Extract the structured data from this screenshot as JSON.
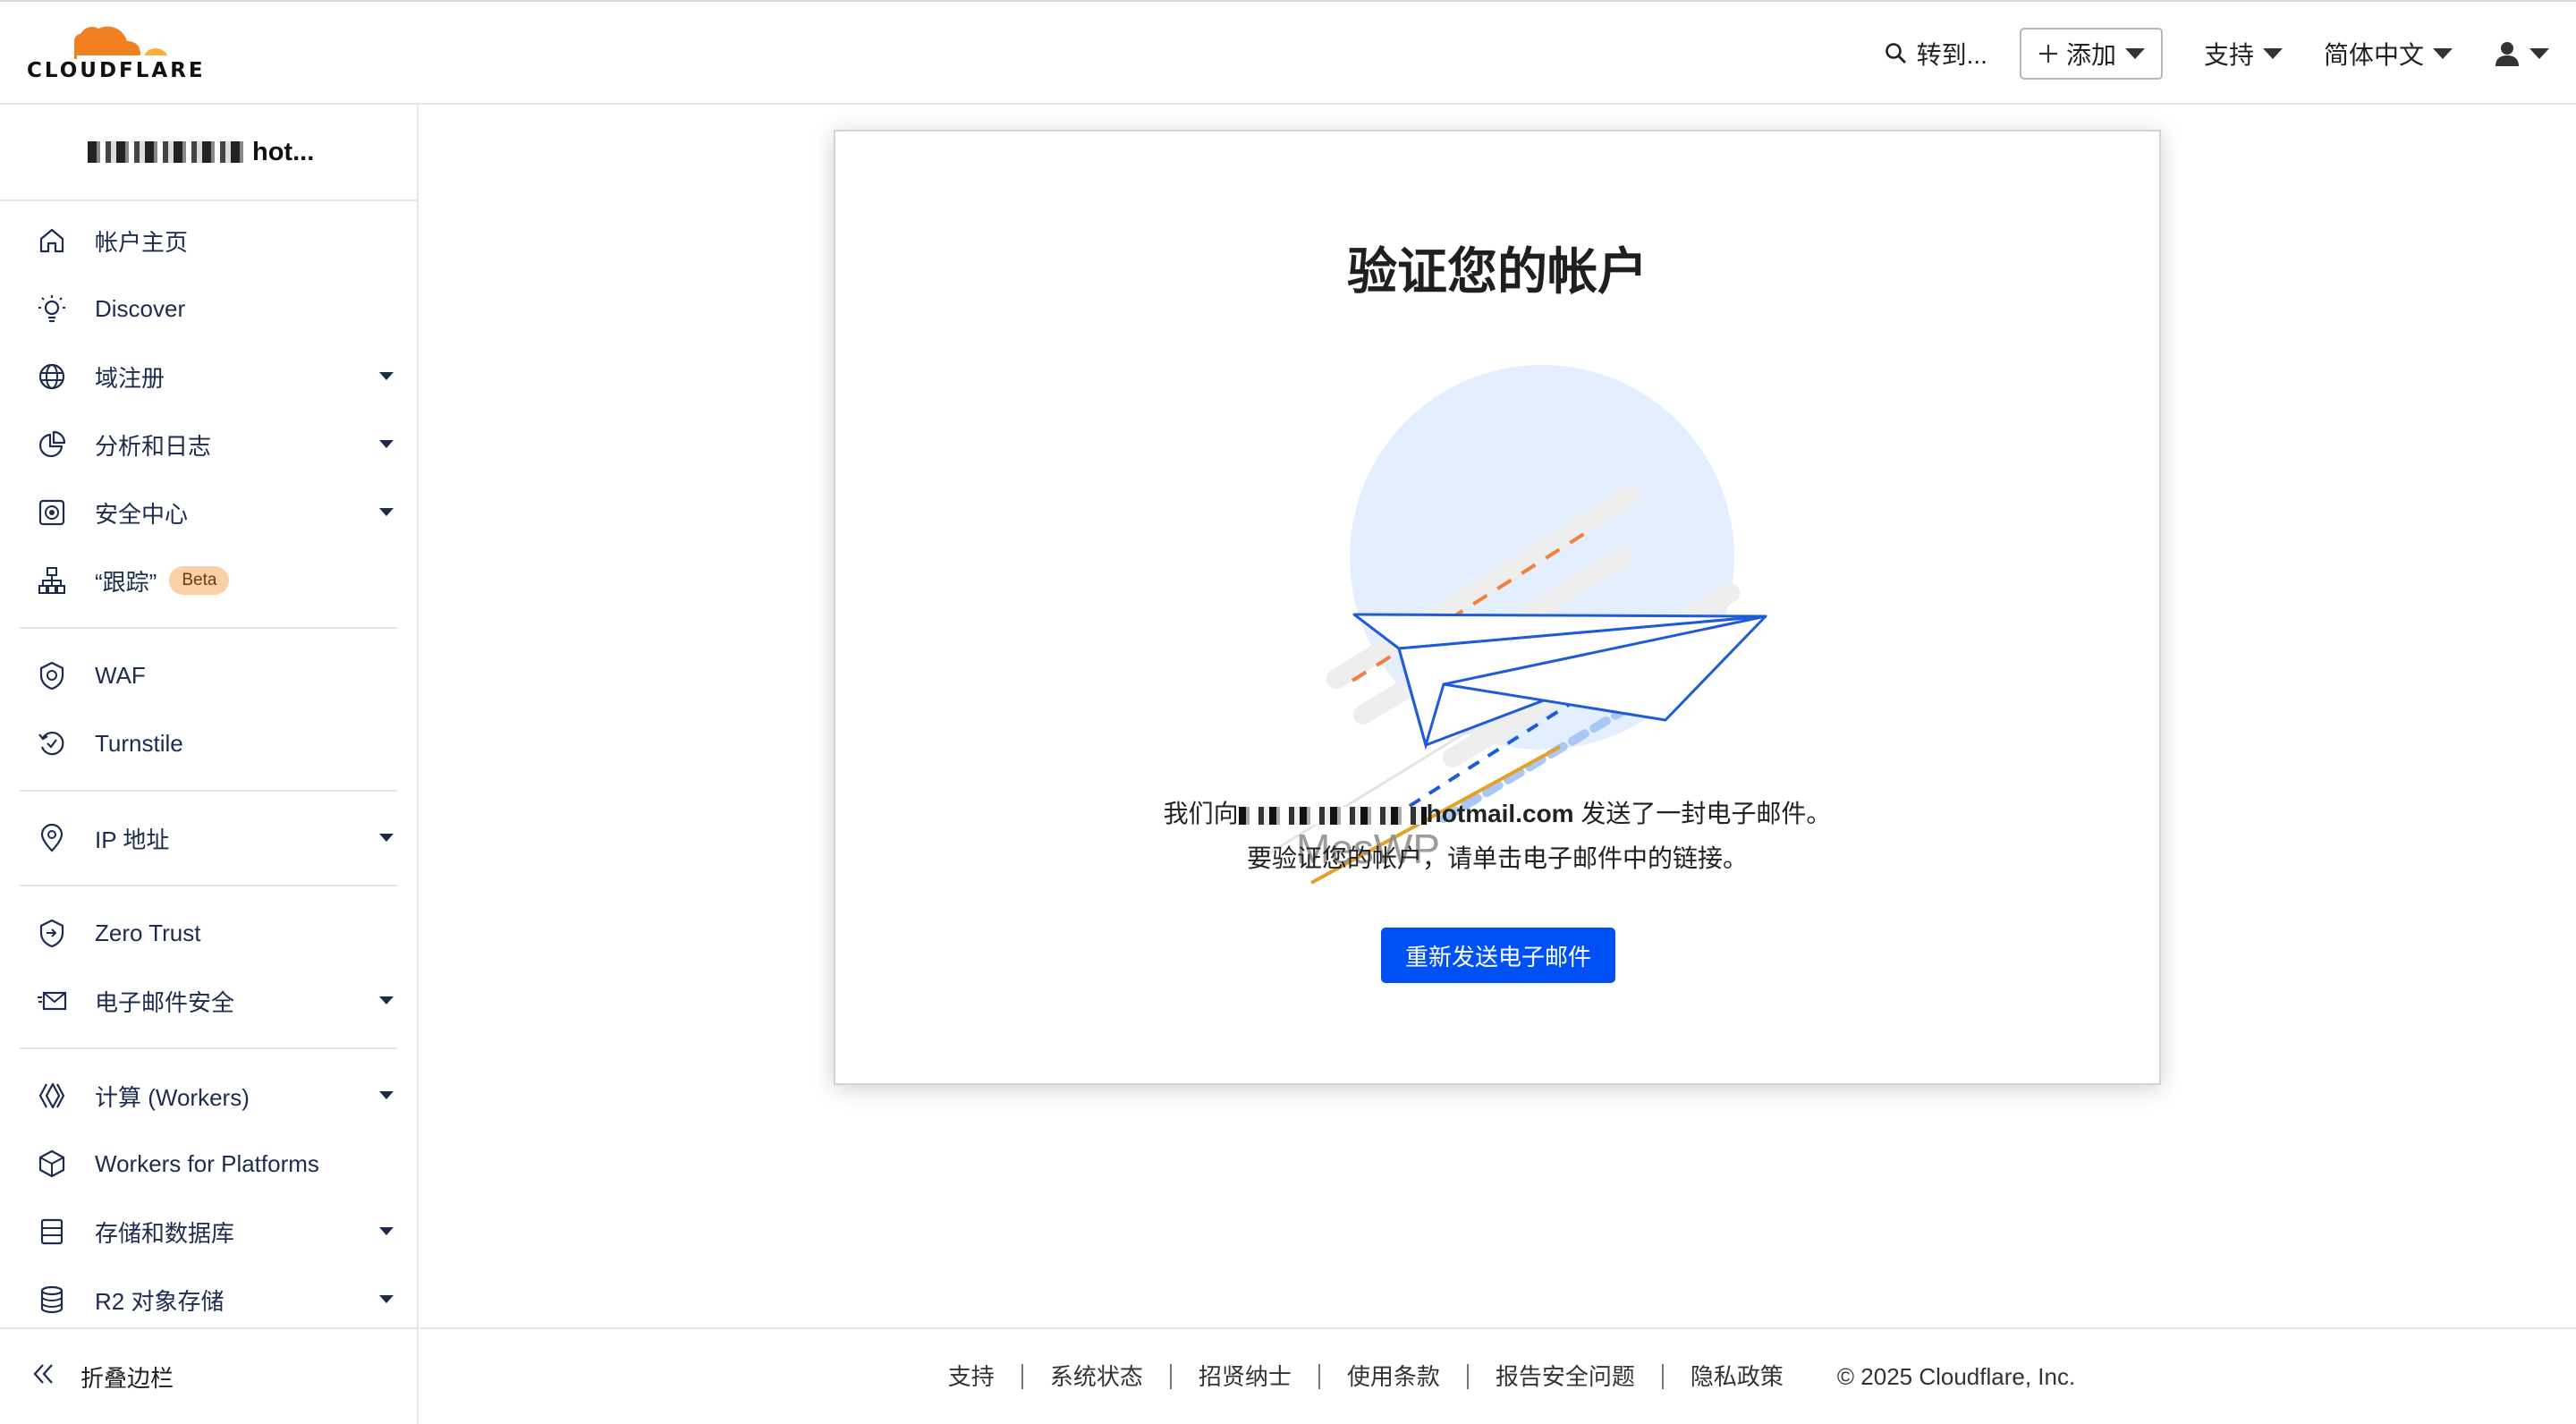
{
  "header": {
    "logo_text": "CLOUDFLARE",
    "goto_label": "转到...",
    "add_label": "添加",
    "support_label": "支持",
    "language_label": "简体中文"
  },
  "sidebar": {
    "account_suffix": "hot...",
    "items": [
      {
        "label": "帐户主页",
        "icon": "home-icon"
      },
      {
        "label": "Discover",
        "icon": "lightbulb-icon"
      },
      {
        "label": "域注册",
        "icon": "globe-icon"
      },
      {
        "label": "分析和日志",
        "icon": "pie-chart-icon"
      },
      {
        "label": "安全中心",
        "icon": "security-center-icon"
      },
      {
        "label": "“跟踪”",
        "icon": "sitemap-icon",
        "badge": "Beta"
      },
      {
        "label": "WAF",
        "icon": "waf-shield-icon"
      },
      {
        "label": "Turnstile",
        "icon": "turnstile-icon"
      },
      {
        "label": "IP 地址",
        "icon": "location-pin-icon"
      },
      {
        "label": "Zero Trust",
        "icon": "zero-trust-icon"
      },
      {
        "label": "电子邮件安全",
        "icon": "email-security-icon"
      },
      {
        "label": "计算 (Workers)",
        "icon": "workers-icon"
      },
      {
        "label": "Workers for Platforms",
        "icon": "cube-icon"
      },
      {
        "label": "存储和数据库",
        "icon": "storage-icon"
      },
      {
        "label": "R2 对象存储",
        "icon": "database-icon"
      }
    ],
    "collapse_label": "折叠边栏"
  },
  "main": {
    "title": "验证您的帐户",
    "watermark": "MesWP",
    "message_prefix": "我们向",
    "email_suffix": "hotmail.com",
    "message_after_email": " 发送了一封电子邮件。",
    "message_line2": "要验证您的帐户，请单击电子邮件中的链接。",
    "resend_label": "重新发送电子邮件"
  },
  "footer": {
    "links": [
      "支持",
      "系统状态",
      "招贤纳士",
      "使用条款",
      "报告安全问题",
      "隐私政策"
    ],
    "copyright": "© 2025 Cloudflare, Inc."
  },
  "colors": {
    "primary_button": "#0051f5",
    "nav_text": "#1d2b4f",
    "logo_orange": "#f38020",
    "beta_badge": "#fbd0a6"
  }
}
